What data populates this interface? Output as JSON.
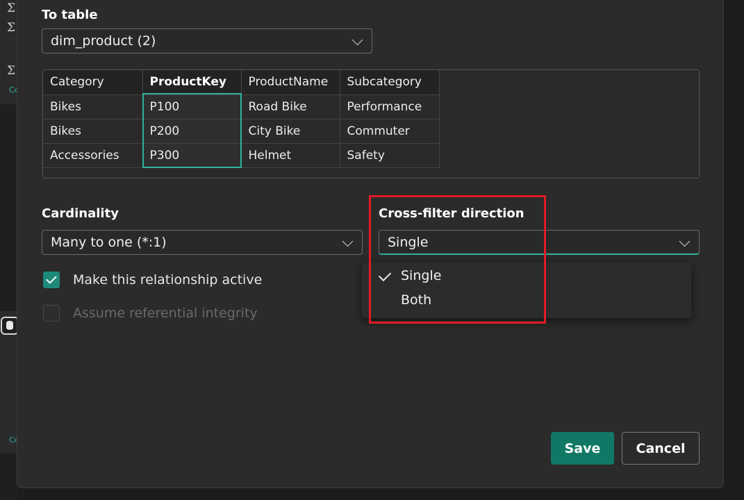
{
  "background": {
    "sigma_glyph": "Σ",
    "links": [
      "Co",
      "Co"
    ],
    "icon": "database-icon"
  },
  "dialog": {
    "to_table_label": "To table",
    "to_table_value": "dim_product (2)",
    "preview_table": {
      "columns": [
        "Category",
        "ProductKey",
        "ProductName",
        "Subcategory"
      ],
      "key_column": "ProductKey",
      "rows": [
        [
          "Bikes",
          "P100",
          "Road Bike",
          "Performance"
        ],
        [
          "Bikes",
          "P200",
          "City Bike",
          "Commuter"
        ],
        [
          "Accessories",
          "P300",
          "Helmet",
          "Safety"
        ]
      ]
    },
    "cardinality_label": "Cardinality",
    "cardinality_value": "Many to one (*:1)",
    "cross_filter_label": "Cross-filter direction",
    "cross_filter_value": "Single",
    "cross_filter_options": [
      {
        "label": "Single",
        "selected": true
      },
      {
        "label": "Both",
        "selected": false
      }
    ],
    "make_active_label": "Make this relationship active",
    "make_active_checked": true,
    "referential_label": "Assume referential integrity",
    "referential_checked": false,
    "save_label": "Save",
    "cancel_label": "Cancel"
  },
  "colors": {
    "accent": "#2fb3a0",
    "save_button": "#117865",
    "highlight_box": "#e01c24"
  }
}
